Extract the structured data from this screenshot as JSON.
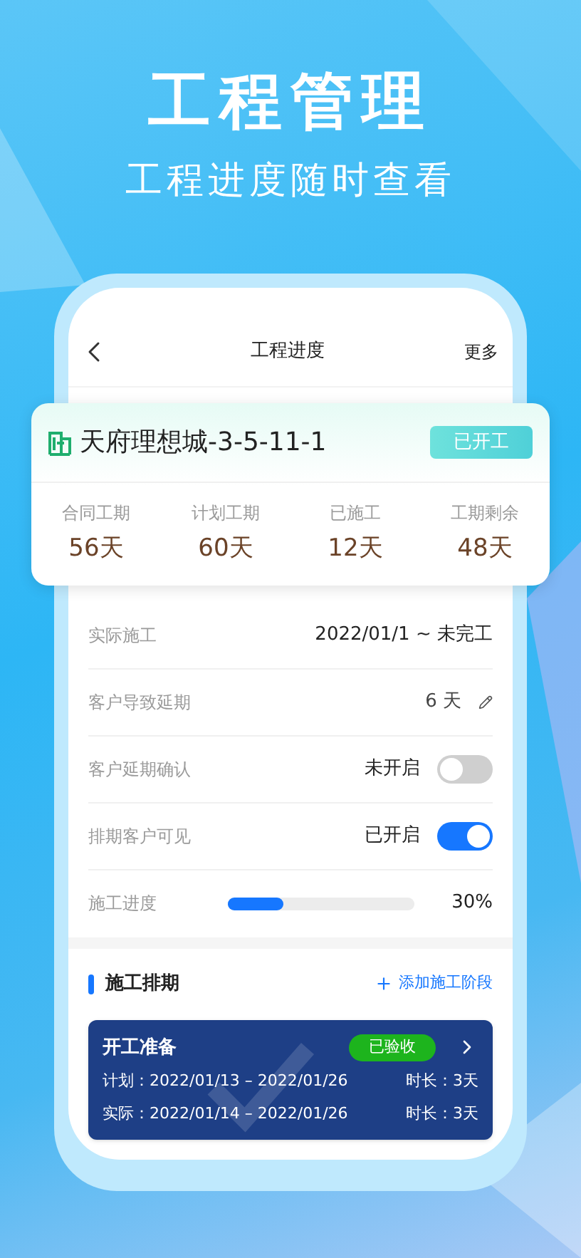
{
  "headline": "工程管理",
  "subheadline": "工程进度随时查看",
  "nav": {
    "title": "工程进度",
    "action": "更多"
  },
  "project": {
    "name": "天府理想城-3-5-11-1",
    "status": "已开工",
    "stats": [
      {
        "label": "合同工期",
        "value": "56天"
      },
      {
        "label": "计划工期",
        "value": "60天"
      },
      {
        "label": "已施工",
        "value": "12天"
      },
      {
        "label": "工期剩余",
        "value": "48天"
      }
    ]
  },
  "rows": [
    {
      "kind": "text",
      "label": "实际施工",
      "value": "2022/01/1 ~ 未完工"
    },
    {
      "kind": "editable",
      "label": "客户导致延期",
      "value": "6 天"
    },
    {
      "kind": "toggle",
      "label": "客户延期确认",
      "value": "未开启",
      "on": false
    },
    {
      "kind": "toggle",
      "label": "排期客户可见",
      "value": "已开启",
      "on": true
    },
    {
      "kind": "progress",
      "label": "施工进度",
      "level": 0.3,
      "value": "30%"
    }
  ],
  "schedule": {
    "title": "施工排期",
    "add_action": "添加施工阶段",
    "stages": [
      {
        "name": "开工准备",
        "status": "已验收",
        "plan": "计划：2022/01/13 – 2022/01/26",
        "plan_duration": "时长：3天",
        "actual": "实际：2022/01/14 – 2022/01/26",
        "actual_duration": "时长：3天"
      }
    ]
  }
}
